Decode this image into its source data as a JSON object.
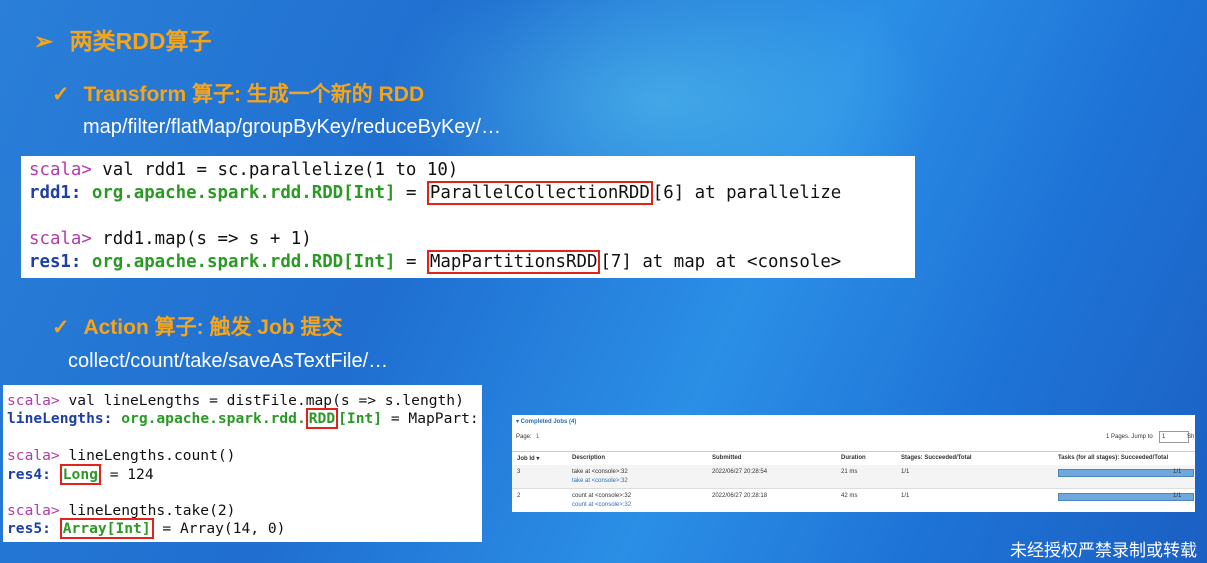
{
  "slide": {
    "title": "两类RDD算子",
    "bullet_marker": "➢",
    "check_marker": "✓",
    "transform": {
      "heading": "Transform 算子: 生成一个新的 RDD",
      "ops": "map/filter/flatMap/groupByKey/reduceByKey/…"
    },
    "action": {
      "heading": "Action 算子: 触发 Job 提交",
      "ops": "collect/count/take/saveAsTextFile/…"
    }
  },
  "code1": {
    "line1_prompt": "scala>",
    "line1_cmd": " val rdd1 = sc.parallelize(1 to 10)",
    "line2_name": "rdd1",
    "line2_type": "org.apache.spark.rdd.RDD[Int]",
    "line2_eq": " = ",
    "line2_boxed": "ParallelCollectionRDD",
    "line2_rest": "[6] at parallelize",
    "line3_prompt": "scala>",
    "line3_cmd": " rdd1.map(s => s + 1)",
    "line4_name": "res1",
    "line4_type": "org.apache.spark.rdd.RDD[Int]",
    "line4_eq": " = ",
    "line4_boxed": "MapPartitionsRDD",
    "line4_rest": "[7] at map at <console>"
  },
  "code2": {
    "l1_prompt": "scala>",
    "l1_cmd": " val lineLengths = distFile.map(s => s.length)",
    "l2_name": "lineLengths",
    "l2_type_a": "org.apache.spark.rdd.",
    "l2_boxed": "RDD",
    "l2_type_b": "[Int]",
    "l2_rest": " = MapPart:",
    "l3_prompt": "scala>",
    "l3_cmd": " lineLengths.count()",
    "l4_name": "res4",
    "l4_boxed": "Long",
    "l4_rest": " = 124",
    "l5_prompt": "scala>",
    "l5_cmd": " lineLengths.take(2)",
    "l6_name": "res5",
    "l6_boxed": "Array[Int]",
    "l6_rest": " = Array(14, 0)"
  },
  "jobs_panel": {
    "title": "▾ Completed Jobs (4)",
    "page_label": "Page:",
    "page_value": "1",
    "pages_info": "1 Pages. Jump to",
    "jump_value": "1",
    "show_label": "Sh",
    "headers": [
      "Job Id ▾",
      "Description",
      "Submitted",
      "Duration",
      "Stages: Succeeded/Total",
      "Tasks (for all stages): Succeeded/Total"
    ],
    "rows": [
      {
        "id": "3",
        "desc": "take at <console>:32",
        "link": "take at <console>:32",
        "submitted": "2022/06/27 20:28:54",
        "duration": "21 ms",
        "stages": "1/1",
        "tasks": "1/1",
        "progress": 1.0
      },
      {
        "id": "2",
        "desc": "count at <console>:32",
        "link": "count at <console>:32",
        "submitted": "2022/06/27 20:28:18",
        "duration": "42 ms",
        "stages": "1/1",
        "tasks": "1/1",
        "progress": 1.0
      }
    ]
  },
  "watermark": "未经授权严禁录制或转载"
}
